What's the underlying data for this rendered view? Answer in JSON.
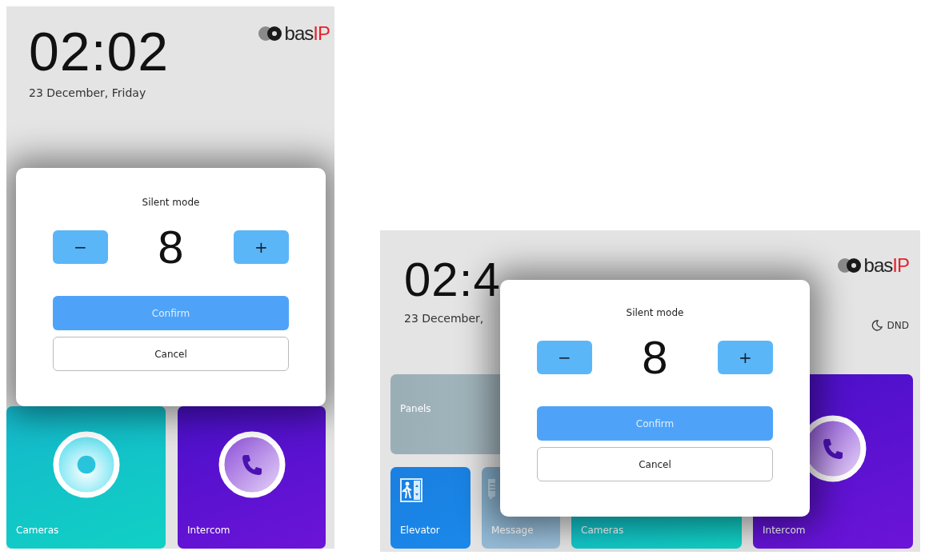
{
  "screens": [
    {
      "kind": "portrait",
      "clock": "02:02",
      "date": "23 December, Friday",
      "logo": {
        "prefix": "bas",
        "accent": "IP"
      },
      "tiles": [
        {
          "kind": "cameras",
          "label": "Cameras"
        },
        {
          "kind": "intercom",
          "label": "Intercom"
        }
      ],
      "dialog": {
        "title": "Silent mode",
        "minus": "−",
        "value": "8",
        "plus": "+",
        "confirm": "Confirm",
        "cancel": "Cancel"
      }
    },
    {
      "kind": "landscape",
      "clock": "02:4",
      "date": "23 December,",
      "logo": {
        "prefix": "bas",
        "accent": "IP"
      },
      "dnd": "DND",
      "tiles": [
        {
          "kind": "panels",
          "label": "Panels"
        },
        {
          "kind": "elevator",
          "label": "Elevator"
        },
        {
          "kind": "message",
          "label": "Message"
        },
        {
          "kind": "cameras",
          "label": "Cameras"
        },
        {
          "kind": "intercom",
          "label": "Intercom"
        }
      ],
      "dialog": {
        "title": "Silent mode",
        "minus": "−",
        "value": "8",
        "plus": "+",
        "confirm": "Confirm",
        "cancel": "Cancel"
      }
    }
  ]
}
